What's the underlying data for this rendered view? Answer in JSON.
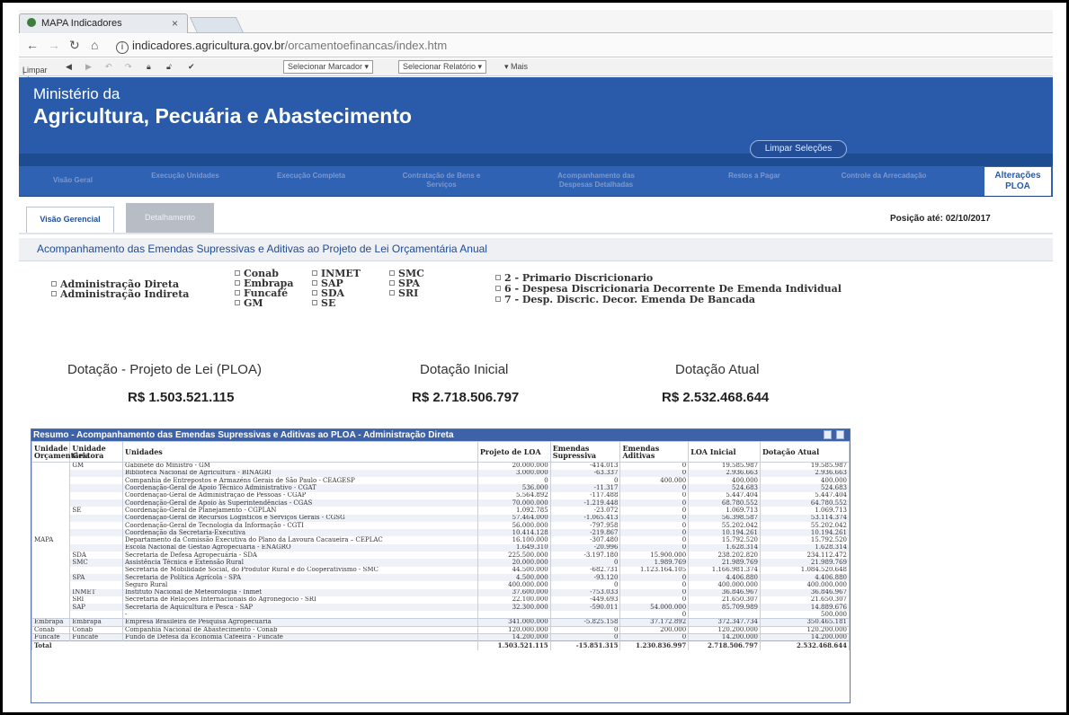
{
  "browser": {
    "tab_title": "MAPA Indicadores",
    "tab_close": "×",
    "url_host": "indicadores.agricultura.gov.br",
    "url_path": "/orcamentoefinancas/index.htm",
    "toolbar": {
      "limpar": "Limpar",
      "marcador": "Selecionar Marcador ▾",
      "relatorio": "Selecionar Relatório ▾",
      "mais": "▾ Mais"
    }
  },
  "header": {
    "line1": "Ministério da",
    "line2": "Agricultura, Pecuária e Abastecimento",
    "clear_button": "Limpar Seleções"
  },
  "nav": {
    "items": [
      "Visão Geral",
      "Execução Unidades",
      "Execução Completa",
      "Contratação de Bens e Serviços",
      "Acompanhamento das Despesas Detalhadas",
      "Restos a Pagar",
      "Controle da Arrecadação"
    ],
    "last": "Alterações PLOA"
  },
  "subtabs": {
    "tab1": "Visão Gerencial",
    "tab2": "Detalhamento",
    "posicao": "Posição até: 02/10/2017"
  },
  "section_title": "Acompanhamento das Emendas Supressivas e Aditivas ao Projeto de Lei Orçamentária Anual",
  "filters": {
    "admin": [
      "Administração Direta",
      "Administração Indireta"
    ],
    "col1": [
      "Conab",
      "Embrapa",
      "Funcafé",
      "GM"
    ],
    "col2": [
      "INMET",
      "SAP",
      "SDA",
      "SE"
    ],
    "col3": [
      "SMC",
      "SPA",
      "SRI"
    ],
    "despesas": [
      "2 - Primario Discricionario",
      "6 - Despesa Discricionaria Decorrente De Emenda Individual",
      "7 - Desp. Discric. Decor. Emenda De Bancada"
    ]
  },
  "kpis": {
    "ploa_label": "Dotação - Projeto de Lei (PLOA)",
    "ploa_value": "R$ 1.503.521.115",
    "inicial_label": "Dotação Inicial",
    "inicial_value": "R$ 2.718.506.797",
    "atual_label": "Dotação Atual",
    "atual_value": "R$ 2.532.468.644"
  },
  "table": {
    "title": "Resumo - Acompanhamento das Emendas Supressivas e Aditivas ao PLOA - Administração Direta",
    "headers": [
      "Unidade Orçamentária",
      "Unidade Gestora",
      "Unidades",
      "Projeto de LOA",
      "Emendas Supressiva",
      "Emendas Aditivas",
      "LOA Inicial",
      "Dotação Atual"
    ],
    "rows": [
      [
        "GM",
        "Gabinete do Ministro - GM",
        "20.000.000",
        "-414.013",
        "0",
        "19.585.987",
        "19.585.987"
      ],
      [
        "",
        "Biblioteca Nacional de Agricultura - BINAGRI",
        "3.000.000",
        "-63.337",
        "0",
        "2.936.663",
        "2.936.663"
      ],
      [
        "",
        "Companhia de Entrepostos e Armazéns Gerais de São Paulo - CEAGESP",
        "0",
        "0",
        "400.000",
        "400.000",
        "400.000"
      ],
      [
        "",
        "Coordenação-Geral de Apoio Técnico Administrativo - CGAT",
        "536.000",
        "-11.317",
        "0",
        "524.683",
        "524.683"
      ],
      [
        "",
        "Coordenação-Geral de Administração de Pessoas - CGAP",
        "5.564.892",
        "-117.488",
        "0",
        "5.447.404",
        "5.447.404"
      ],
      [
        "",
        "Coordenação-Geral de Apoio às Superintendências - CGAS",
        "70.000.000",
        "-1.219.448",
        "0",
        "68.780.552",
        "64.780.552"
      ],
      [
        "SE",
        "Coordenação-Geral de Planejamento - CGPLAN",
        "1.092.785",
        "-23.072",
        "0",
        "1.069.713",
        "1.069.713"
      ],
      [
        "",
        "Coordenação-Geral de Recursos Logísticos e Serviços Gerais - CGSG",
        "57.464.000",
        "-1.065.413",
        "0",
        "56.398.587",
        "53.114.374"
      ],
      [
        "",
        "Coordenação-Geral de Tecnologia da Informação - CGTI",
        "56.000.000",
        "-797.958",
        "0",
        "55.202.042",
        "55.202.042"
      ],
      [
        "",
        "Coordenação da Secretaria-Executiva",
        "10.414.128",
        "-219.867",
        "0",
        "10.194.261",
        "10.194.261"
      ],
      [
        "",
        "Departamento da Comissão Executiva do Plano da Lavoura Cacaueira – CEPLAC",
        "16.100.000",
        "-307.480",
        "0",
        "15.792.520",
        "15.792.520"
      ],
      [
        "",
        "Escola Nacional de Gestão Agropecuária - ENAGRO",
        "1.649.310",
        "-20.996",
        "0",
        "1.628.314",
        "1.628.314"
      ],
      [
        "SDA",
        "Secretaria de Defesa Agropecuária - SDA",
        "225.500.000",
        "-3.197.180",
        "15.900.000",
        "238.202.820",
        "234.112.472"
      ],
      [
        "SMC",
        "Assistência Técnica e Extensão Rural",
        "20.000.000",
        "0",
        "1.989.769",
        "21.989.769",
        "21.989.769"
      ],
      [
        "",
        "Secretaria de Mobilidade Social, do Produtor Rural e do Cooperativismo - SMC",
        "44.500.000",
        "-682.731",
        "1.123.164.105",
        "1.166.981.374",
        "1.084.520.648"
      ],
      [
        "SPA",
        "Secretaria de Política Agrícola - SPA",
        "4.500.000",
        "-93.120",
        "0",
        "4.406.880",
        "4.406.880"
      ],
      [
        "",
        "Seguro Rural",
        "400.000.000",
        "0",
        "0",
        "400.000.000",
        "400.000.000"
      ],
      [
        "INMET",
        "Instituto Nacional de Meteorologia - Inmet",
        "37.600.000",
        "-753.033",
        "0",
        "36.846.967",
        "36.846.967"
      ],
      [
        "SRI",
        "Secretaria de Relações Internacionais do Agronegócio - SRI",
        "22.100.000",
        "-449.693",
        "0",
        "21.650.307",
        "21.650.307"
      ],
      [
        "SAP",
        "Secretaria de Aquicultura e Pesca - SAP",
        "32.300.000",
        "-590.011",
        "54.000.000",
        "85.709.989",
        "14.889.676"
      ],
      [
        "",
        "-",
        "",
        "",
        "0",
        "",
        "500.000"
      ]
    ],
    "bottom_rows": [
      [
        "Embrapa",
        "Embrapa",
        "Empresa Brasileira de Pesquisa Agropecuária",
        "341.000.000",
        "-5.825.158",
        "37.172.892",
        "372.347.734",
        "350.465.181"
      ],
      [
        "Conab",
        "Conab",
        "Companhia Nacional de Abastecimento - Conab",
        "120.000.000",
        "0",
        "200.000",
        "120.200.000",
        "120.200.000"
      ],
      [
        "Funcafé",
        "Funcafé",
        "Fundo de Defesa da Economia Cafeeira - Funcafé",
        "14.200.000",
        "0",
        "0",
        "14.200.000",
        "14.200.000"
      ]
    ],
    "group_mapa": "MAPA",
    "total": [
      "Total",
      "1.503.521.115",
      "-15.851.315",
      "1.230.836.997",
      "2.718.506.797",
      "2.532.468.644"
    ]
  }
}
